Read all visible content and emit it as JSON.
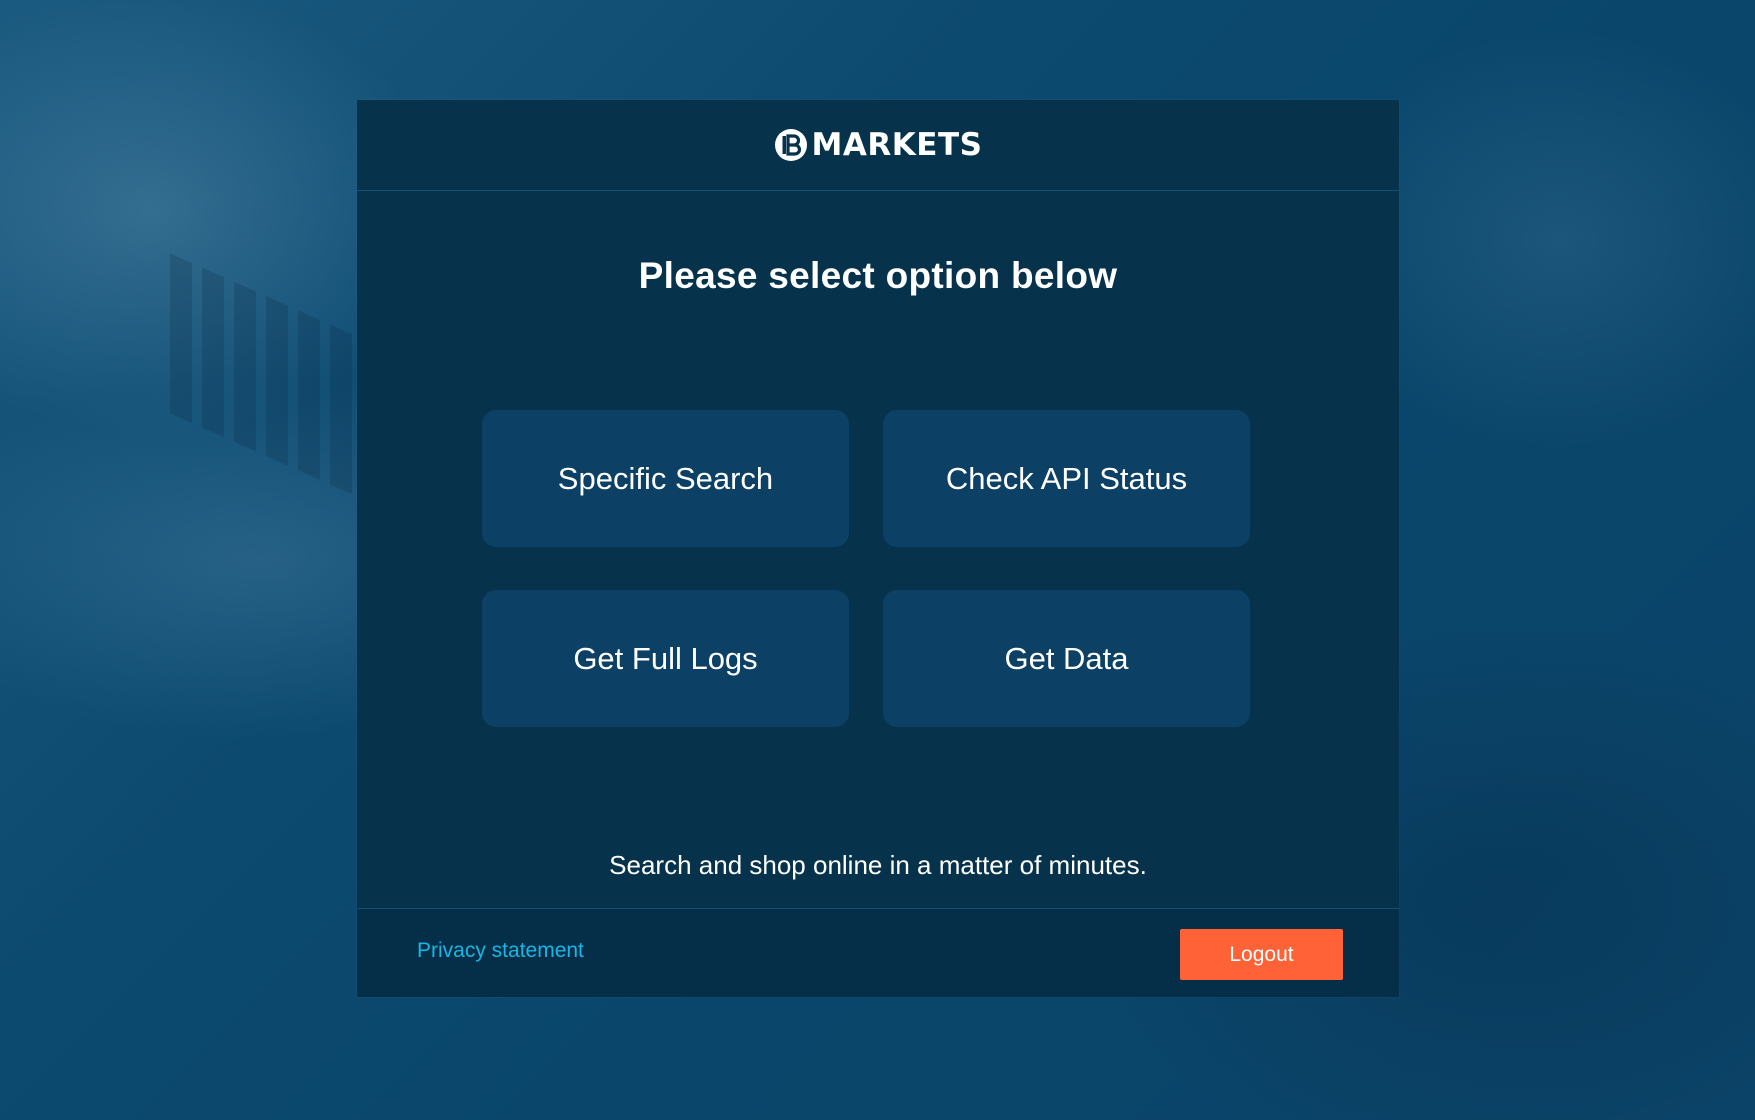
{
  "brand": {
    "name": "MARKETS",
    "logo_icon": "ib-circle-logo-icon"
  },
  "main": {
    "title": "Please select option below",
    "options": [
      {
        "label": "Specific Search"
      },
      {
        "label": "Check API Status"
      },
      {
        "label": "Get Full Logs"
      },
      {
        "label": "Get Data"
      }
    ],
    "tagline": "Search and shop online in a matter of minutes."
  },
  "footer": {
    "privacy_label": "Privacy statement",
    "logout_label": "Logout"
  },
  "colors": {
    "card_bg": "#06324c",
    "option_bg": "#0c4064",
    "link": "#16b6e6",
    "logout_bg": "#ff6236",
    "page_bg": "#0a4366"
  }
}
